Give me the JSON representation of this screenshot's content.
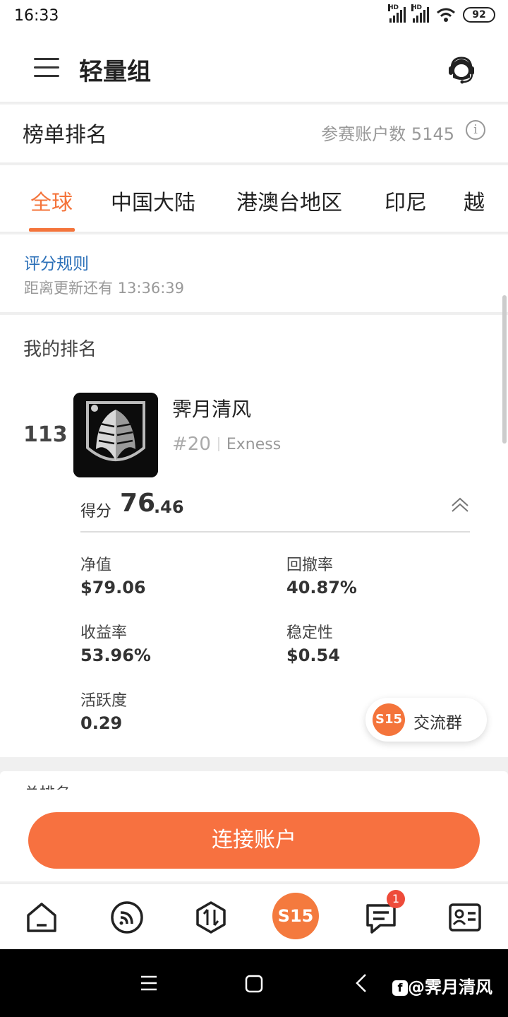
{
  "status_bar": {
    "time": "16:33",
    "signal1": "HD",
    "signal2": "HD",
    "battery": "92"
  },
  "header": {
    "title": "轻量组"
  },
  "ranking": {
    "title": "榜单排名",
    "participants_label": "参赛账户数",
    "participants_count": "5145"
  },
  "tabs": [
    {
      "label": "全球"
    },
    {
      "label": "中国大陆"
    },
    {
      "label": "港澳台地区"
    },
    {
      "label": "印尼"
    },
    {
      "label": "越"
    }
  ],
  "rules": {
    "link": "评分规则",
    "countdown_label": "距离更新还有",
    "countdown": "13:36:39"
  },
  "my_rank": {
    "title": "我的排名",
    "rank": "113",
    "name": "霁月清风",
    "sub_rank": "#20",
    "broker": "Exness",
    "score_label": "得分",
    "score_int": "76",
    "score_dec": ".46",
    "metrics": [
      {
        "label": "净值",
        "value": "$79.06"
      },
      {
        "label": "回撤率",
        "value": "40.87%"
      },
      {
        "label": "收益率",
        "value": "53.96%"
      },
      {
        "label": "稳定性",
        "value": "$0.54"
      },
      {
        "label": "活跃度",
        "value": "0.29"
      }
    ]
  },
  "chat_group": {
    "logo": "S15",
    "label": "交流群"
  },
  "next_card": {
    "title": "总排名"
  },
  "connect_button": "连接账户",
  "bottom_nav": {
    "center_logo": "S15",
    "message_badge": "1"
  },
  "watermark": "@霁月清风",
  "colors": {
    "accent": "#f4743b",
    "link": "#2a6fb8",
    "badge": "#ee4b3a"
  }
}
